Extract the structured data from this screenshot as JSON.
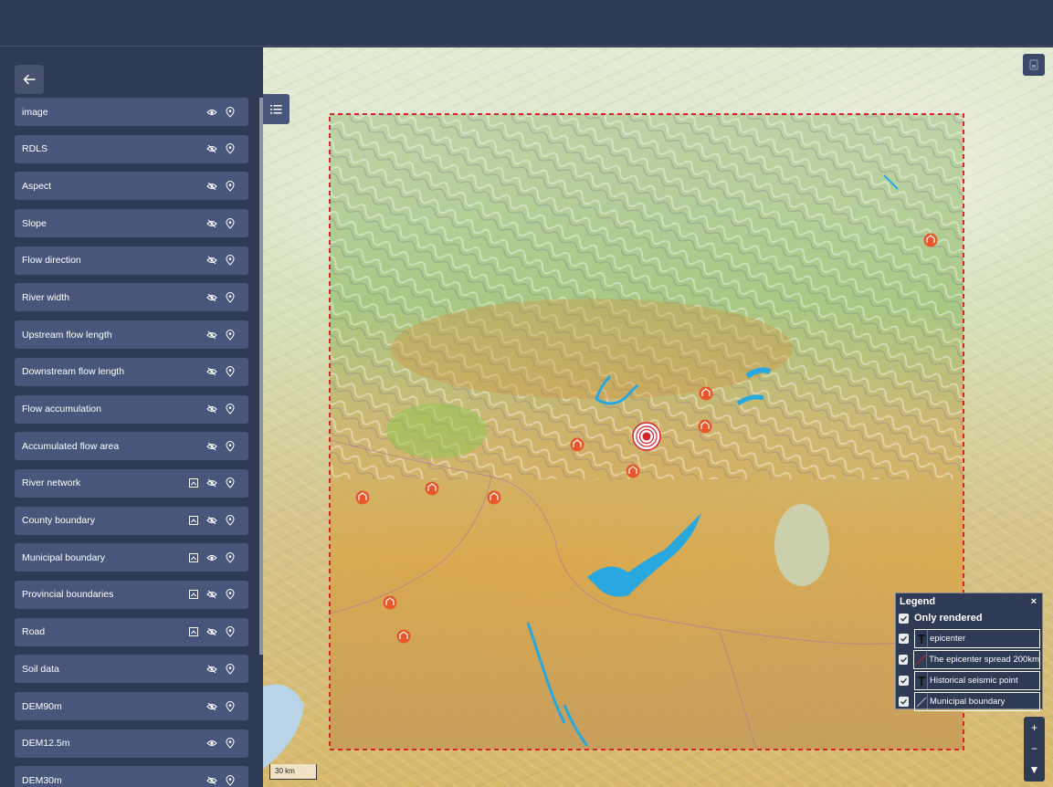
{
  "sidebar": {
    "back_icon": "arrow-left-icon",
    "layers": [
      {
        "label": "image",
        "has_style": false,
        "visible": true
      },
      {
        "label": "RDLS",
        "has_style": false,
        "visible": false
      },
      {
        "label": "Aspect",
        "has_style": false,
        "visible": false
      },
      {
        "label": "Slope",
        "has_style": false,
        "visible": false
      },
      {
        "label": "Flow direction",
        "has_style": false,
        "visible": false
      },
      {
        "label": "River width",
        "has_style": false,
        "visible": false
      },
      {
        "label": "Upstream flow length",
        "has_style": false,
        "visible": false
      },
      {
        "label": "Downstream flow length",
        "has_style": false,
        "visible": false
      },
      {
        "label": "Flow accumulation",
        "has_style": false,
        "visible": false
      },
      {
        "label": "Accumulated flow area",
        "has_style": false,
        "visible": false
      },
      {
        "label": "River network",
        "has_style": true,
        "visible": false
      },
      {
        "label": "County boundary",
        "has_style": true,
        "visible": false
      },
      {
        "label": "Municipal boundary",
        "has_style": true,
        "visible": true
      },
      {
        "label": "Provincial boundaries",
        "has_style": true,
        "visible": false
      },
      {
        "label": "Road",
        "has_style": true,
        "visible": false
      },
      {
        "label": "Soil data",
        "has_style": false,
        "visible": false
      },
      {
        "label": "DEM90m",
        "has_style": false,
        "visible": false
      },
      {
        "label": "DEM12.5m",
        "has_style": false,
        "visible": true
      },
      {
        "label": "DEM30m",
        "has_style": false,
        "visible": false
      }
    ]
  },
  "legend": {
    "title": "Legend",
    "close": "×",
    "only_rendered": "Only rendered",
    "items": [
      {
        "label": "epicenter",
        "symbol": "T"
      },
      {
        "label": "The epicenter spread 200km",
        "symbol": "line-red"
      },
      {
        "label": "Historical seismic point",
        "symbol": "T"
      },
      {
        "label": "Municipal boundary",
        "symbol": "line-gray"
      }
    ]
  },
  "map": {
    "scale_label": "30 km",
    "zoom_in": "+",
    "zoom_out": "−",
    "zoom_more": "▼",
    "accent": "#e8572a",
    "boundary_color": "#d8232a"
  }
}
